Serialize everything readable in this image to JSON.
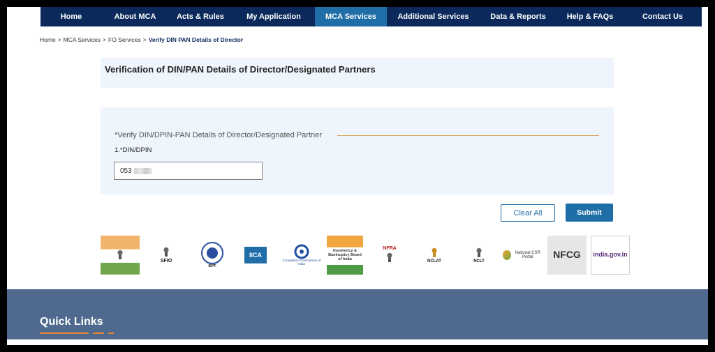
{
  "nav": {
    "items": [
      {
        "label": "Home"
      },
      {
        "label": "About MCA"
      },
      {
        "label": "Acts & Rules"
      },
      {
        "label": "My Application"
      },
      {
        "label": "MCA Services"
      },
      {
        "label": "Additional Services"
      },
      {
        "label": "Data & Reports"
      },
      {
        "label": "Help & FAQs"
      },
      {
        "label": "Contact Us"
      }
    ],
    "active": "MCA Services",
    "colors": {
      "background": "#0b2a5b",
      "active": "#1f6ea8"
    }
  },
  "breadcrumb": {
    "items": [
      "Home",
      "MCA Services",
      "FO Services",
      "Verify DIN PAN Details of Director"
    ],
    "separator": ">"
  },
  "page": {
    "title": "Verification of DIN/PAN Details of Director/Designated Partners"
  },
  "form": {
    "legend": "*Verify DIN/DPIN-PAN Details of Director/Designated Partner",
    "din_label": "1.*DIN/DPIN",
    "din_value": "053"
  },
  "buttons": {
    "clear": "Clear All",
    "submit": "Submit"
  },
  "logos": {
    "sfio": "SFIO",
    "iepf": "IEPF",
    "iica": "IICA",
    "cci": "Competition Commission of India",
    "ibbi": "Insolvency & Bankruptcy Board of India",
    "nfra": "NFRA",
    "nclat": "NCLAT",
    "nclt": "NCLT",
    "csr": "National CSR Portal",
    "nfcg": "NFCG",
    "indiagov": "india.gov.in"
  },
  "footer": {
    "quick_links": "Quick Links",
    "accent": "#e38a2a"
  }
}
